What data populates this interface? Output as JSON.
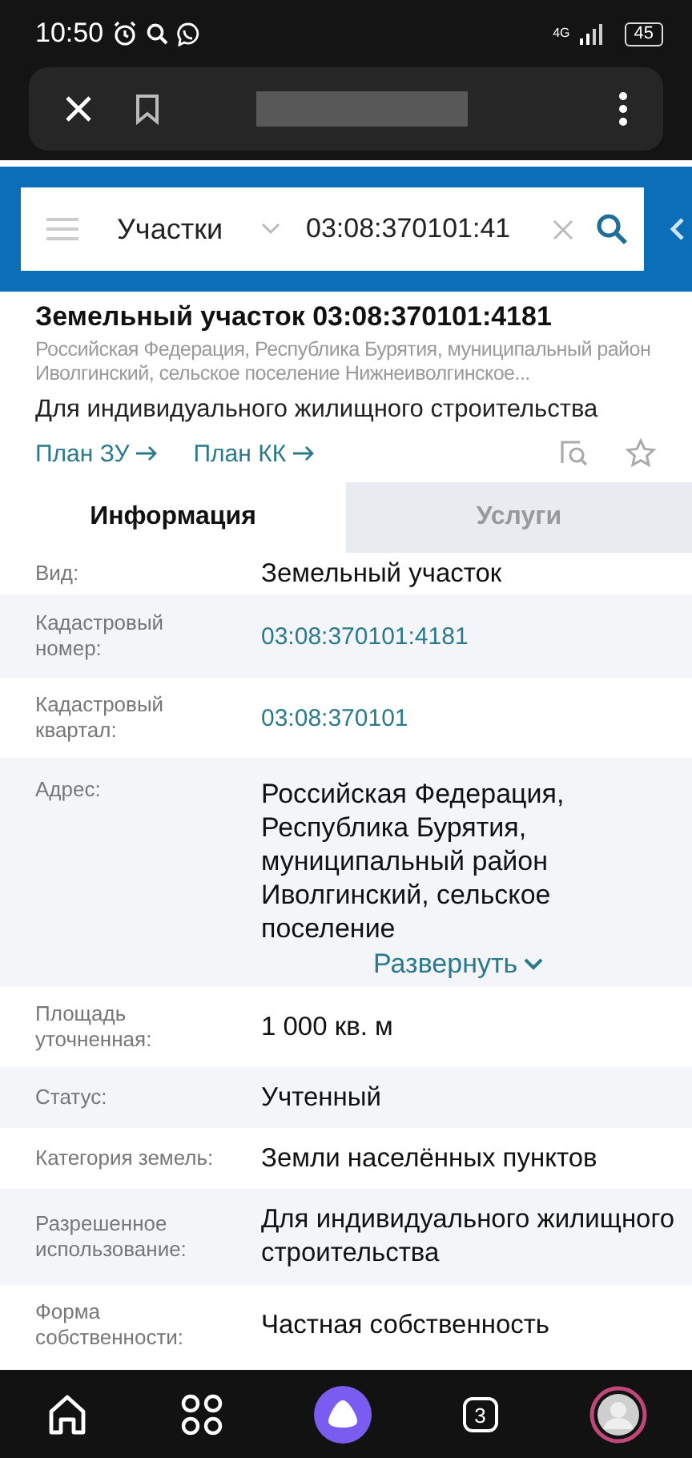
{
  "status_bar": {
    "time": "10:50",
    "network": "4G",
    "battery": "45"
  },
  "search": {
    "category": "Участки",
    "value": "03:08:370101:41"
  },
  "card": {
    "title": "Земельный участок 03:08:370101:4181",
    "address": "Российская Федерация, Республика Бурятия, муниципальный район Иволгинский, сельское поселение Нижнеиволгинское...",
    "purpose": "Для индивидуального жилищного строительства",
    "links": [
      "План ЗУ",
      "План КК"
    ]
  },
  "tabs": [
    {
      "label": "Информация",
      "selected": true
    },
    {
      "label": "Услуги",
      "selected": false
    }
  ],
  "rows": [
    {
      "label": "Вид:",
      "value": "Земельный участок",
      "kind": "text"
    },
    {
      "label": "Кадастровый номер:",
      "value": "03:08:370101:4181",
      "kind": "link"
    },
    {
      "label": "Кадастровый квартал:",
      "value": "03:08:370101",
      "kind": "link"
    },
    {
      "label": "Адрес:",
      "value": "Российская Федерация, Республика Бурятия, муниципальный район Иволгинский, сельское поселение",
      "kind": "collapsed",
      "expand": "Развернуть"
    },
    {
      "label": "Площадь уточненная:",
      "value": "1 000 кв. м",
      "kind": "text"
    },
    {
      "label": "Статус:",
      "value": "Учтенный",
      "kind": "text"
    },
    {
      "label": "Категория земель:",
      "value": "Земли населённых пунктов",
      "kind": "text"
    },
    {
      "label": "Разрешенное использование:",
      "value": "Для индивидуального жилищного строительства",
      "kind": "text"
    },
    {
      "label": "Форма собственности:",
      "value": "Частная собственность",
      "kind": "text"
    }
  ],
  "nav": {
    "tab_count": "3"
  }
}
